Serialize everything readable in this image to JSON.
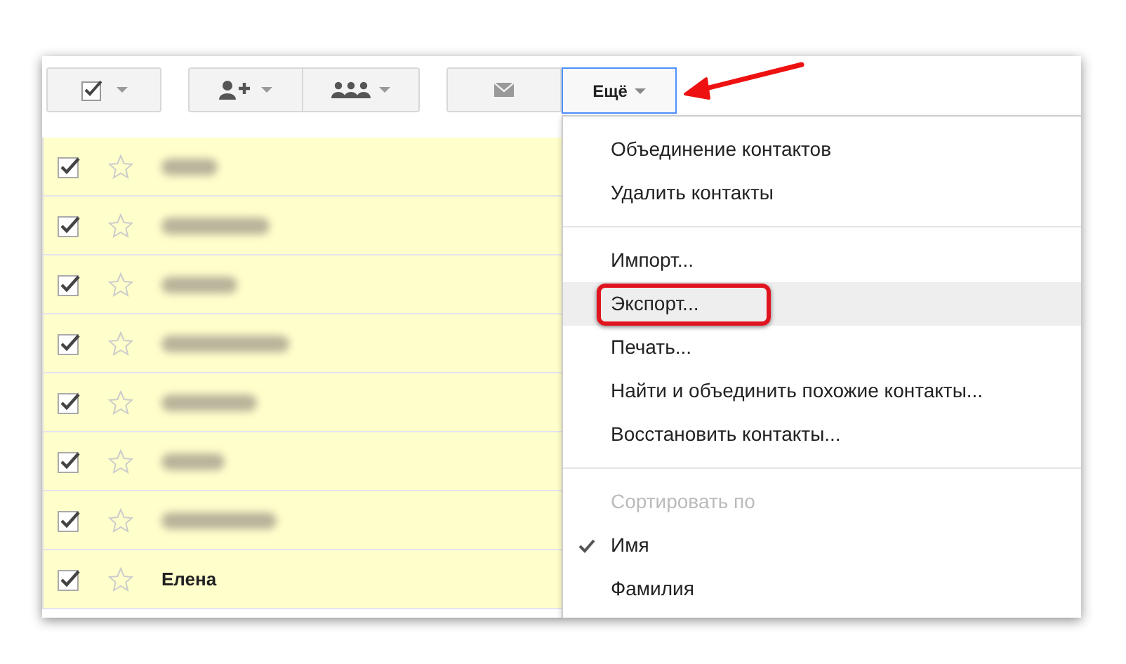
{
  "toolbar": {
    "more_button": {
      "label": "Ещё",
      "pointed_at": true
    }
  },
  "contacts": [
    {
      "kind": "blurred",
      "checked": true,
      "starred": false
    },
    {
      "kind": "blurred",
      "checked": true,
      "starred": false
    },
    {
      "kind": "blurred",
      "checked": true,
      "starred": false
    },
    {
      "kind": "blurred",
      "checked": true,
      "starred": false
    },
    {
      "kind": "blurred",
      "checked": true,
      "starred": false
    },
    {
      "kind": "blurred",
      "checked": true,
      "starred": false
    },
    {
      "kind": "blurred",
      "checked": true,
      "starred": false
    },
    {
      "kind": "plain",
      "name": "Елена",
      "checked": true,
      "starred": false
    }
  ],
  "menu": [
    {
      "kind": "item",
      "label": "Объединение контактов",
      "highlighted": false,
      "circled": false
    },
    {
      "kind": "item",
      "label": "Удалить контакты",
      "highlighted": false,
      "circled": false
    },
    {
      "kind": "separator"
    },
    {
      "kind": "item",
      "label": "Импорт...",
      "highlighted": false,
      "circled": false
    },
    {
      "kind": "item",
      "label": "Экспорт...",
      "highlighted": true,
      "circled": true
    },
    {
      "kind": "item",
      "label": "Печать...",
      "highlighted": false,
      "circled": false
    },
    {
      "kind": "item",
      "label": "Найти и объединить похожие контакты...",
      "highlighted": false,
      "circled": false
    },
    {
      "kind": "item",
      "label": "Восстановить контакты...",
      "highlighted": false,
      "circled": false
    },
    {
      "kind": "separator"
    },
    {
      "kind": "heading",
      "label": "Сортировать по"
    },
    {
      "kind": "option",
      "label": "Имя",
      "selected": true
    },
    {
      "kind": "option",
      "label": "Фамилия",
      "selected": false
    }
  ]
}
